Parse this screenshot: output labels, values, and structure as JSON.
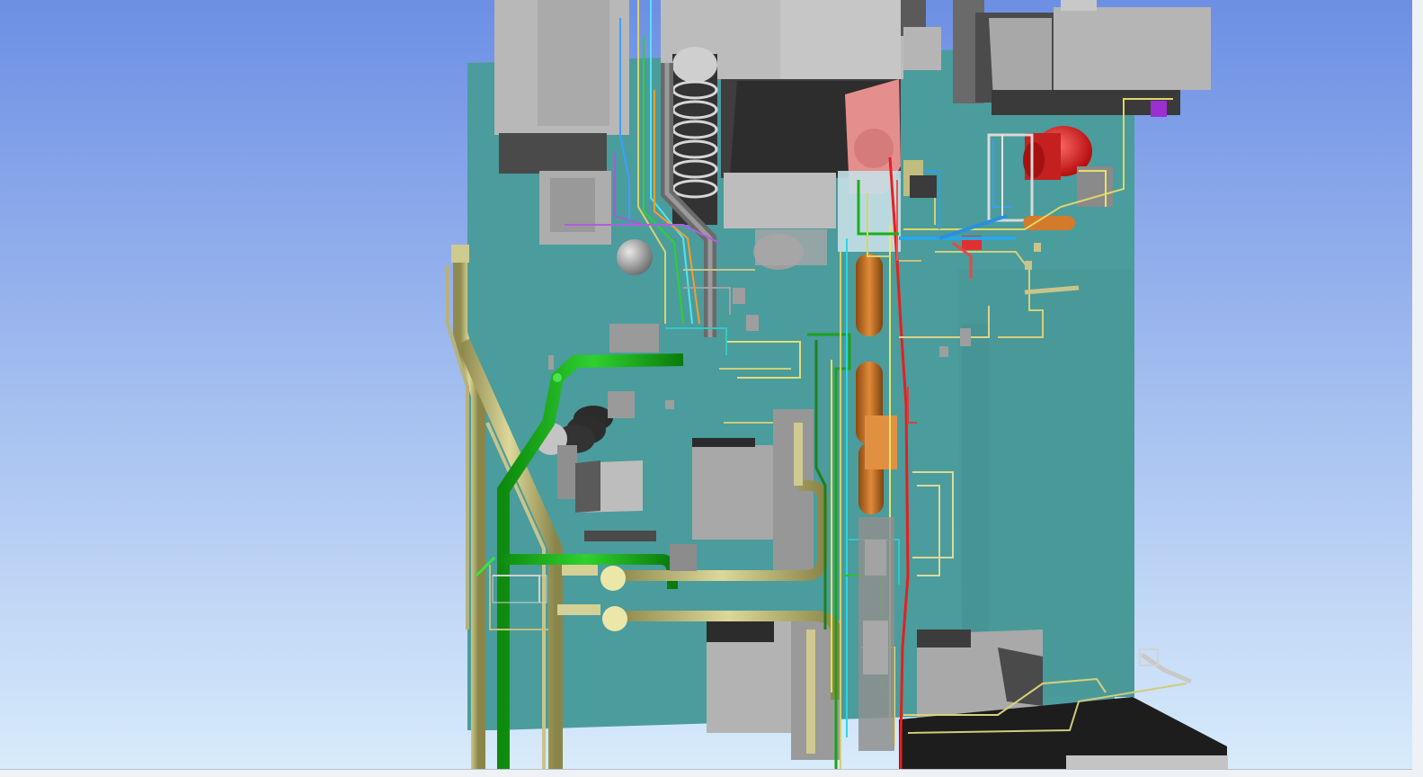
{
  "viewer": {
    "scene": "plant-3d-model",
    "background_top": "#6d8fe4",
    "background_bottom": "#d9ecfb",
    "floor_color": "#4b9c9c",
    "equipment_color": "#b3b3b3",
    "main_pipe_color": "#16b416",
    "utility_pipe_color": "#c8c37a",
    "vessel_color": "#c86e1e",
    "tank_color": "#e02424",
    "frame_color": "#eef1f6"
  }
}
